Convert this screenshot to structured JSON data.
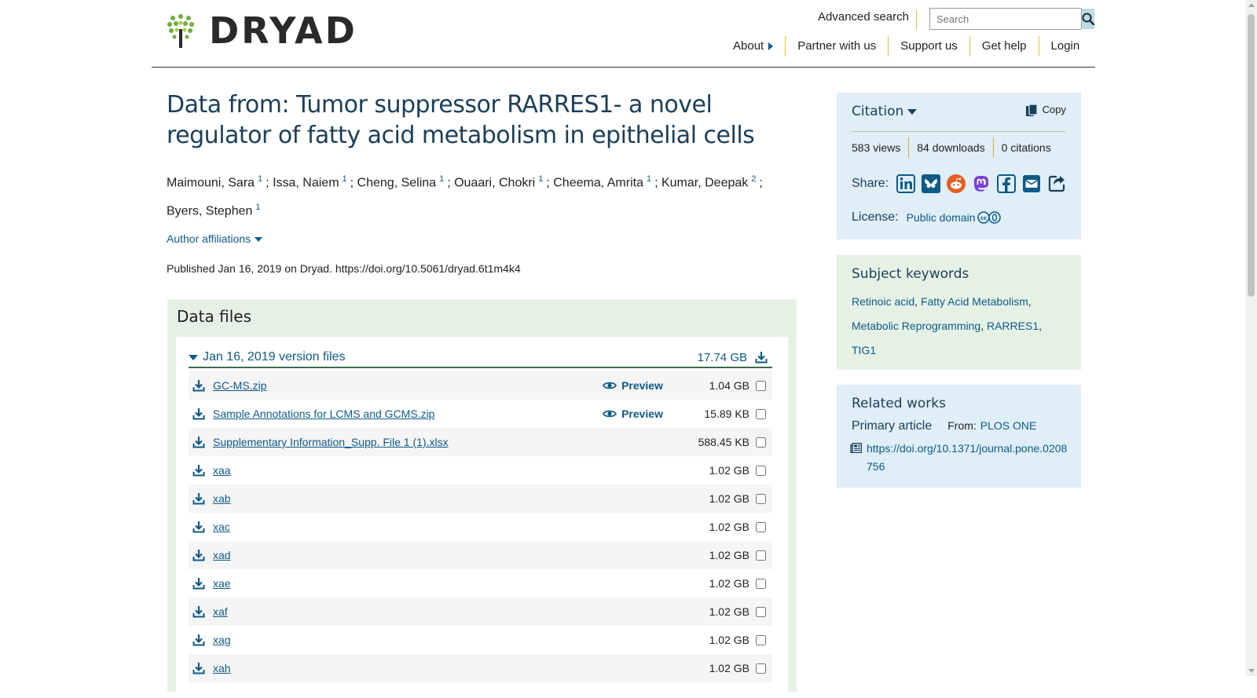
{
  "brand": {
    "name": "DRYAD"
  },
  "header": {
    "advanced_search": "Advanced search",
    "search_placeholder": "Search",
    "nav": [
      {
        "label": "About"
      },
      {
        "label": "Partner with us"
      },
      {
        "label": "Support us"
      },
      {
        "label": "Get help"
      },
      {
        "label": "Login"
      }
    ]
  },
  "dataset": {
    "title": "Data from: Tumor suppressor RARRES1- a novel regulator of fatty acid metabolism in epithelial cells",
    "authors": [
      {
        "name": "Maimouni, Sara",
        "aff": "1"
      },
      {
        "name": "Issa, Naiem",
        "aff": "1"
      },
      {
        "name": "Cheng, Selina",
        "aff": "1"
      },
      {
        "name": "Ouaari, Chokri",
        "aff": "1"
      },
      {
        "name": "Cheema, Amrita",
        "aff": "1"
      },
      {
        "name": "Kumar, Deepak",
        "aff": "2"
      },
      {
        "name": "Byers, Stephen",
        "aff": "1"
      }
    ],
    "author_affiliations_label": "Author affiliations",
    "published": "Published Jan 16, 2019 on Dryad. https://doi.org/10.5061/dryad.6t1m4k4"
  },
  "data_files": {
    "heading": "Data files",
    "version_label": "Jan 16, 2019 version files",
    "version_size": "17.74 GB",
    "preview_label": "Preview",
    "files": [
      {
        "name": "GC-MS.zip",
        "size": "1.04 GB",
        "preview": true
      },
      {
        "name": "Sample Annotations for LCMS and GCMS.zip",
        "size": "15.89 KB",
        "preview": true
      },
      {
        "name": "Supplementary Information_Supp. File 1 (1).xlsx",
        "size": "588.45 KB",
        "preview": false
      },
      {
        "name": "xaa",
        "size": "1.02 GB",
        "preview": false
      },
      {
        "name": "xab",
        "size": "1.02 GB",
        "preview": false
      },
      {
        "name": "xac",
        "size": "1.02 GB",
        "preview": false
      },
      {
        "name": "xad",
        "size": "1.02 GB",
        "preview": false
      },
      {
        "name": "xae",
        "size": "1.02 GB",
        "preview": false
      },
      {
        "name": "xaf",
        "size": "1.02 GB",
        "preview": false
      },
      {
        "name": "xag",
        "size": "1.02 GB",
        "preview": false
      },
      {
        "name": "xah",
        "size": "1.02 GB",
        "preview": false
      }
    ]
  },
  "citation": {
    "title": "Citation",
    "copy_label": "Copy",
    "views": "583 views",
    "downloads": "84 downloads",
    "citations": "0 citations",
    "share_label": "Share:",
    "share_icons": [
      "linkedin-icon",
      "bluesky-icon",
      "reddit-icon",
      "mastodon-icon",
      "facebook-icon",
      "email-icon",
      "share-icon"
    ],
    "license_label": "License:",
    "license_value": "Public domain"
  },
  "keywords": {
    "title": "Subject keywords",
    "items": [
      "Retinoic acid",
      "Fatty Acid Metabolism",
      "Metabolic Reprogramming",
      "RARRES1",
      "TIG1"
    ]
  },
  "related": {
    "title": "Related works",
    "primary_label": "Primary article",
    "from_label": "From:",
    "journal": "PLOS ONE",
    "doi": "https://doi.org/10.1371/journal.pone.0208756"
  },
  "colors": {
    "link": "#0f5a87",
    "heading": "#1b3f58",
    "citation_bg": "#dfeef7",
    "keywords_bg": "#e6f1e6",
    "accent_divider": "#e6c42b"
  }
}
